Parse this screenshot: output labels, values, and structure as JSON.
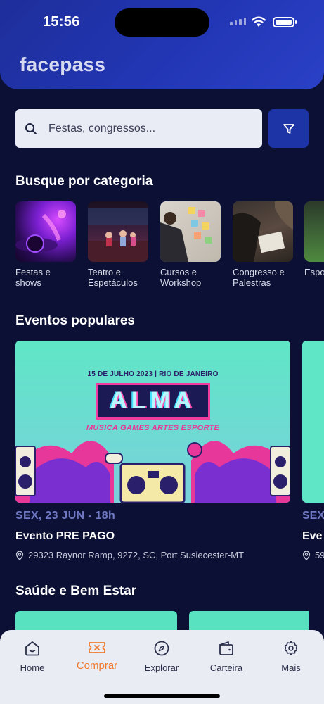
{
  "status_bar": {
    "time": "15:56"
  },
  "header": {
    "logo": "facepass"
  },
  "search": {
    "placeholder": "Festas, congressos..."
  },
  "sections": {
    "categories_title": "Busque por categoria",
    "popular_title": "Eventos populares",
    "health_title": "Saúde e Bem Estar"
  },
  "categories": [
    {
      "label": "Festas e shows",
      "icon": "dj-party-photo"
    },
    {
      "label": "Teatro e Espetáculos",
      "icon": "theater-stage-photo"
    },
    {
      "label": "Cursos e Workshop",
      "icon": "workshop-sticky-notes-photo"
    },
    {
      "label": "Congresso e Palestras",
      "icon": "conference-photo"
    },
    {
      "label": "Espo",
      "icon": "sports-stadium-photo"
    }
  ],
  "events": [
    {
      "banner_date": "15 DE JULHO 2023 | RIO DE JANEIRO",
      "banner_title": "ALMA",
      "banner_subtitle": "MUSICA GAMES ARTES ESPORTE",
      "date": "SEX, 23 JUN - 18h",
      "name": "Evento PRE PAGO",
      "address": "29323 Raynor Ramp, 9272, SC, Port Susiecester-MT"
    },
    {
      "date": "SEX",
      "name": "Eve",
      "address": "59"
    }
  ],
  "bottom_nav": {
    "items": [
      {
        "label": "Home",
        "icon": "home-icon"
      },
      {
        "label": "Comprar",
        "icon": "ticket-icon"
      },
      {
        "label": "Explorar",
        "icon": "compass-icon"
      },
      {
        "label": "Carteira",
        "icon": "wallet-icon"
      },
      {
        "label": "Mais",
        "icon": "gear-icon"
      }
    ],
    "active_index": 1
  },
  "colors": {
    "background": "#0b1034",
    "header": "#2236b5",
    "accent": "#f07a2c",
    "date_text": "#6f78c4",
    "banner": "#5fe6c6"
  }
}
